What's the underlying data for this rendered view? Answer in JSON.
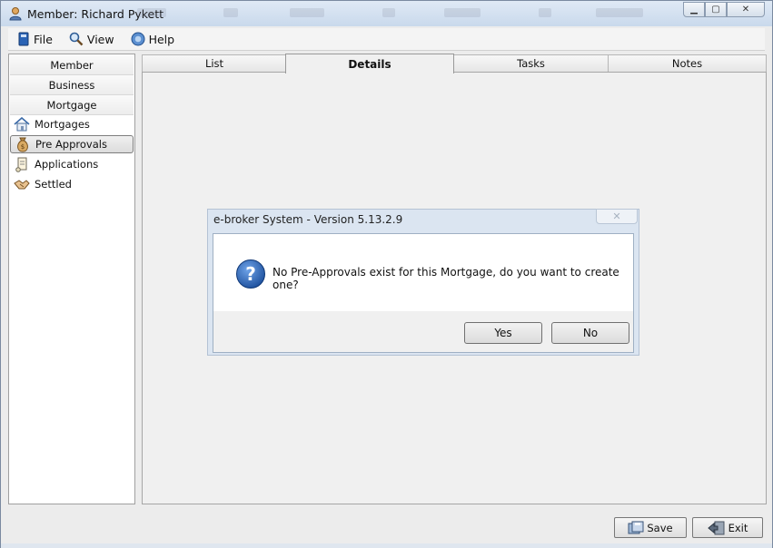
{
  "window": {
    "title": "Member: Richard Pykett"
  },
  "menu": [
    {
      "label": "File",
      "icon": "file-icon"
    },
    {
      "label": "View",
      "icon": "view-icon"
    },
    {
      "label": "Help",
      "icon": "help-icon"
    }
  ],
  "sidebar": {
    "sections": [
      "Member",
      "Business",
      "Mortgage"
    ],
    "items": [
      {
        "label": "Mortgages",
        "icon": "house-icon"
      },
      {
        "label": "Pre Approvals",
        "icon": "money-bag-icon",
        "selected": true
      },
      {
        "label": "Applications",
        "icon": "scroll-icon"
      },
      {
        "label": "Settled",
        "icon": "handshake-icon"
      }
    ]
  },
  "tabs": [
    {
      "label": "List"
    },
    {
      "label": "Details",
      "active": true
    },
    {
      "label": "Tasks"
    },
    {
      "label": "Notes"
    }
  ],
  "dialog": {
    "title": "e-broker System - Version 5.13.2.9",
    "message": "No Pre-Approvals exist for this Mortgage, do you want to create one?",
    "yes_label": "Yes",
    "no_label": "No"
  },
  "footer": {
    "save_label": "Save",
    "exit_label": "Exit"
  },
  "colors": {
    "accent": "#1f5fa8",
    "window_bg": "#ececec",
    "dialog_frame": "#dbe5f1"
  }
}
